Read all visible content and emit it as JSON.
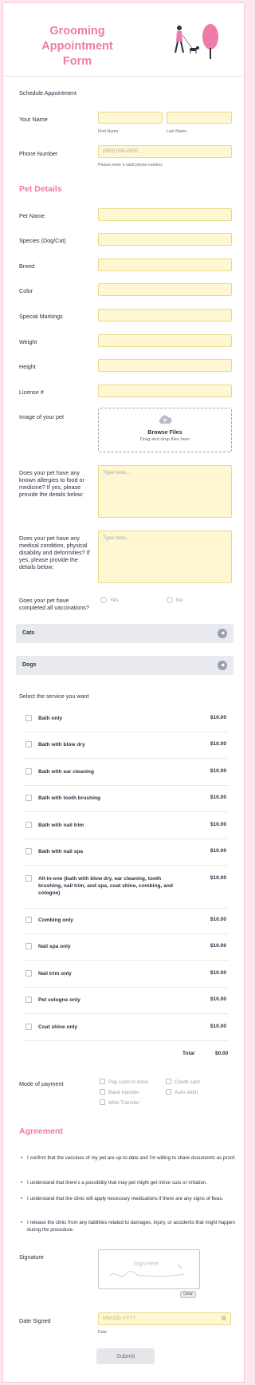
{
  "form": {
    "title_line1": "Grooming Appointment",
    "title_line2": "Form",
    "schedule_heading": "Schedule Appointment",
    "your_name": {
      "label": "Your Name",
      "first_sub": "First Name",
      "last_sub": "Last Name"
    },
    "phone": {
      "label": "Phone Number",
      "placeholder": "(000) 000-0000",
      "hint": "Please enter a valid phone number."
    },
    "pet_details_title": "Pet Details",
    "pet_fields": [
      "Pet Name",
      "Species (Dog/Cat)",
      "Breed",
      "Color",
      "Special Markings",
      "Weight",
      "Height",
      "License #"
    ],
    "image_label": "Image of your pet",
    "upload": {
      "title": "Browse Files",
      "subtitle": "Drag and drop files here"
    },
    "allergy": {
      "label": "Does your pet have any known allergies to food or medicine? If yes, please provide the details below:",
      "placeholder": "Type here..."
    },
    "medical": {
      "label": "Does your pet have any medical condition, physical disability and deformities? If yes, please provide the details below:",
      "placeholder": "Type here..."
    },
    "vaccination": {
      "label": "Does your pet have completed all vaccinations?",
      "yes": "Yes",
      "no": "No"
    },
    "sections": [
      "Cats",
      "Dogs"
    ],
    "service_heading": "Select the service you want",
    "services": [
      {
        "name": "Bath only",
        "price": "$10.00"
      },
      {
        "name": "Bath with blow dry",
        "price": "$10.00"
      },
      {
        "name": "Bath with ear cleaning",
        "price": "$10.00"
      },
      {
        "name": "Bath with tooth brushing",
        "price": "$10.00"
      },
      {
        "name": "Bath with nail trim",
        "price": "$10.00"
      },
      {
        "name": "Bath with nail spa",
        "price": "$10.00"
      },
      {
        "name": "All-in-one (bath with blow dry, ear cleaning, tooth brushing, nail trim, and spa, coat shine, combing, and cologne)",
        "price": "$10.00"
      },
      {
        "name": "Combing only",
        "price": "$10.00"
      },
      {
        "name": "Nail spa only",
        "price": "$10.00"
      },
      {
        "name": "Nail trim only",
        "price": "$10.00"
      },
      {
        "name": "Pet cologne only",
        "price": "$10.00"
      },
      {
        "name": "Coat shine only",
        "price": "$10.00"
      }
    ],
    "total_label": "Total",
    "total_value": "$0.00",
    "payment": {
      "label": "Mode of payment",
      "options": [
        "Pay cash to clinic",
        "Credit card",
        "Bank transfer",
        "Auto debit",
        "Wire Transfer"
      ]
    },
    "agreement_title": "Agreement",
    "agreements": [
      "I confirm that the vaccines of my pet are up-to-date and I'm willing to share documents as proof.",
      "I understand that there's a possibility that may pet might get minor cuts or irritation.",
      "I understand that the clinic will apply necessary medications if there are any signs of fleas.",
      "I release the clinic from any liabilities related to damages, injury, or accidents that might happen during the procedure."
    ],
    "signature": {
      "label": "Signature",
      "placeholder": "Sign Here",
      "clear": "Clear"
    },
    "date": {
      "label": "Date Signed",
      "placeholder": "MM-DD-YYYY",
      "sub": "Date"
    },
    "submit": "Submit"
  },
  "colors": {
    "accent": "#ef7ba8",
    "input_bg": "#fff7d1",
    "page_bg": "#fde7ef"
  }
}
